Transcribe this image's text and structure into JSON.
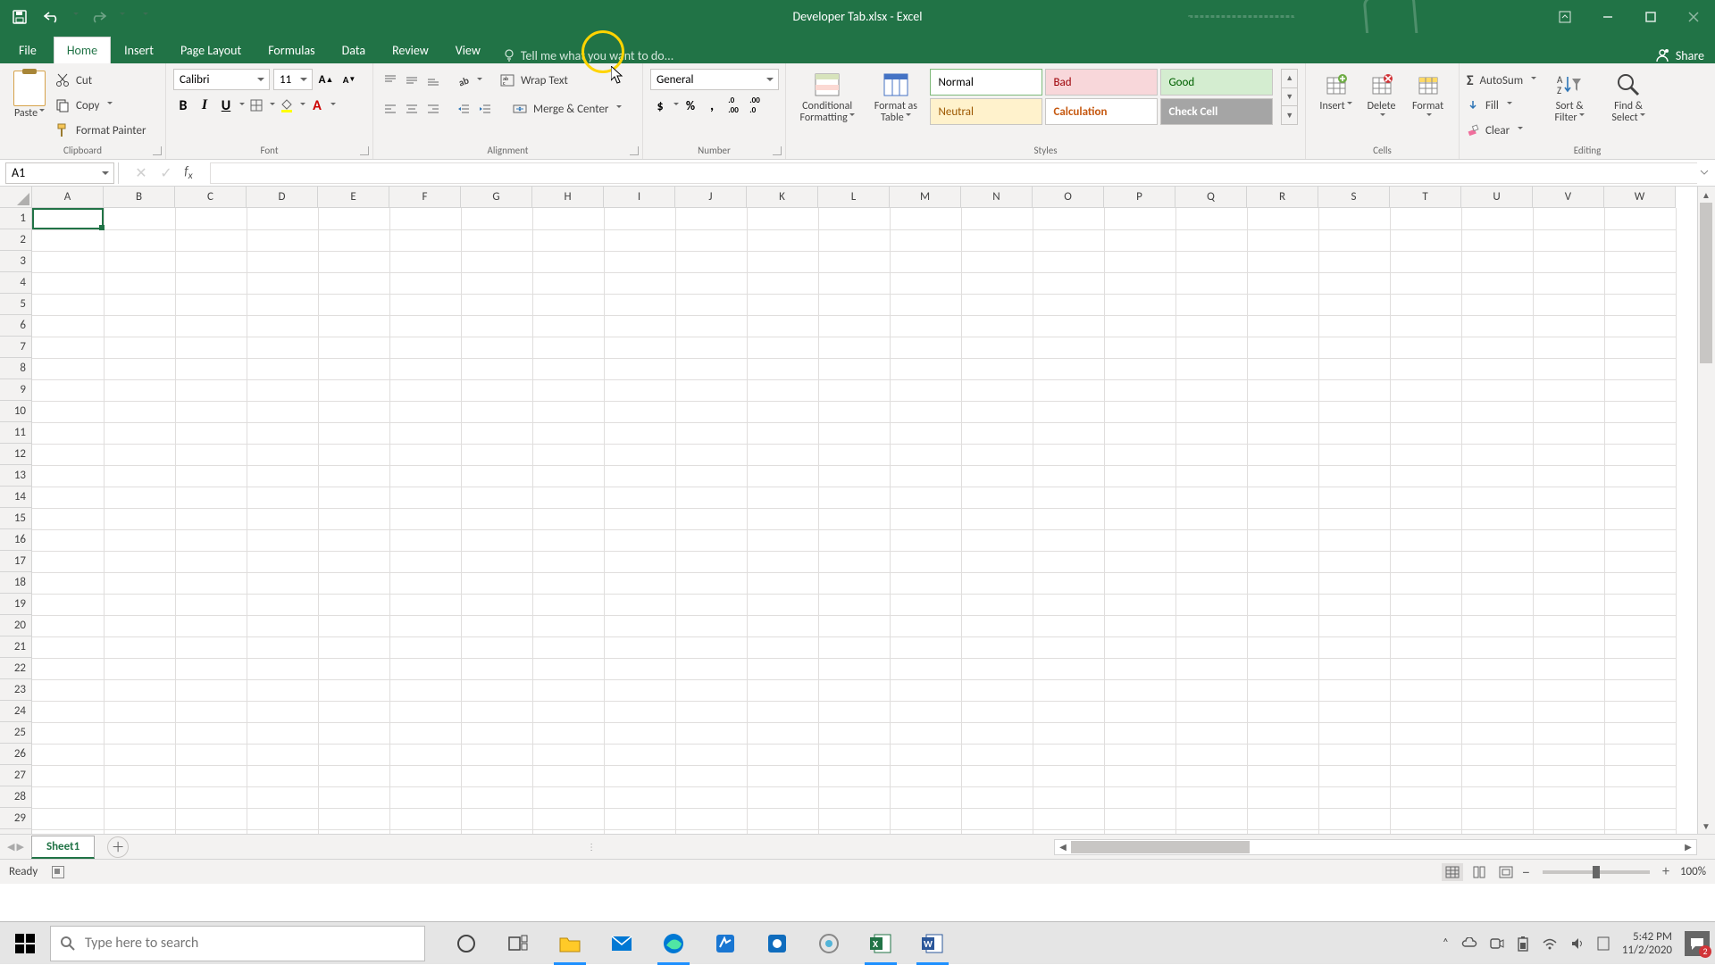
{
  "title": "Developer Tab.xlsx - Excel",
  "menutabs": [
    "File",
    "Home",
    "Insert",
    "Page Layout",
    "Formulas",
    "Data",
    "Review",
    "View"
  ],
  "active_tab": "Home",
  "tellme_placeholder": "Tell me what you want to do...",
  "share": "Share",
  "ribbon": {
    "clipboard": {
      "label": "Clipboard",
      "paste": "Paste",
      "cut": "Cut",
      "copy": "Copy",
      "painter": "Format Painter"
    },
    "font": {
      "label": "Font",
      "name": "Calibri",
      "size": "11"
    },
    "alignment": {
      "label": "Alignment",
      "wrap": "Wrap Text",
      "merge": "Merge & Center"
    },
    "number": {
      "label": "Number",
      "format": "General"
    },
    "styles": {
      "label": "Styles",
      "cond": "Conditional Formatting",
      "table": "Format as Table",
      "cells": [
        "Normal",
        "Bad",
        "Good",
        "Neutral",
        "Calculation",
        "Check Cell"
      ]
    },
    "cells_grp": {
      "label": "Cells",
      "insert": "Insert",
      "delete": "Delete",
      "format": "Format"
    },
    "editing": {
      "label": "Editing",
      "autosum": "AutoSum",
      "fill": "Fill",
      "clear": "Clear",
      "sort": "Sort & Filter",
      "find": "Find & Select"
    }
  },
  "namebox": "A1",
  "columns": [
    "A",
    "B",
    "C",
    "D",
    "E",
    "F",
    "G",
    "H",
    "I",
    "J",
    "K",
    "L",
    "M",
    "N",
    "O",
    "P",
    "Q",
    "R",
    "S",
    "T",
    "U",
    "V",
    "W"
  ],
  "row_count": 30,
  "sheet_tab": "Sheet1",
  "status_ready": "Ready",
  "zoom": "100%",
  "search_placeholder": "Type here to search",
  "clock": {
    "time": "5:42 PM",
    "date": "11/2/2020"
  },
  "notif_count": "2"
}
